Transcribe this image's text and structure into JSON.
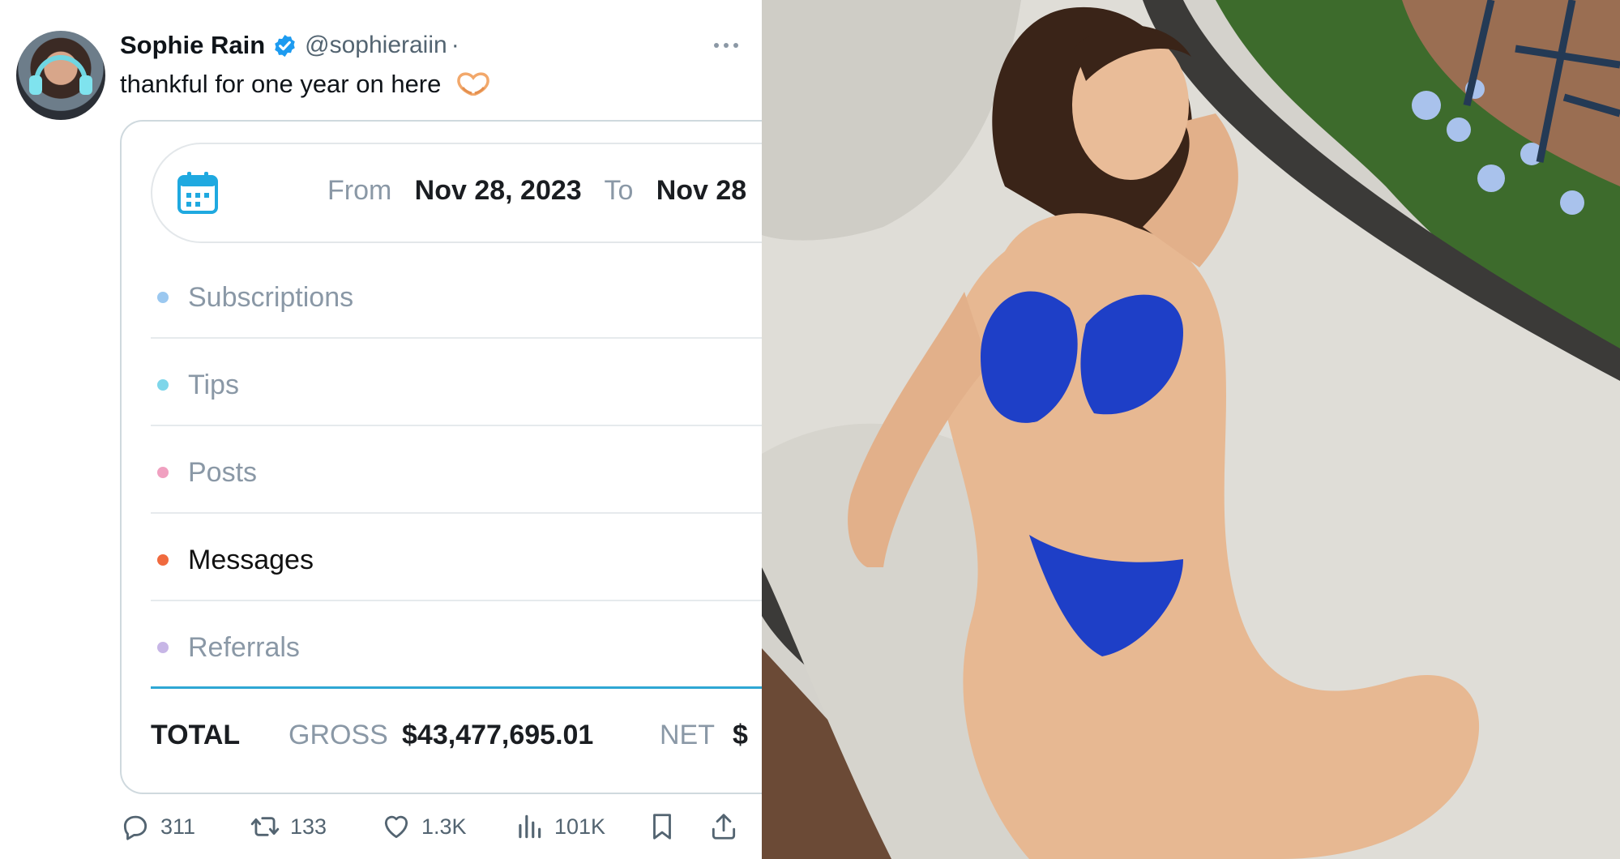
{
  "tweet": {
    "author_name": "Sophie Rain",
    "author_handle": "@sophieraiin",
    "separator": "·",
    "text": "thankful for one year on here",
    "emoji_icon": "heart-hands-icon",
    "verified_color": "#1d9bf0"
  },
  "card": {
    "from_label": "From",
    "from_date": "Nov 28, 2023",
    "to_label": "To",
    "to_date": "Nov 28",
    "categories": [
      {
        "label": "Subscriptions",
        "color": "#9bc8f0"
      },
      {
        "label": "Tips",
        "color": "#7ed6ea"
      },
      {
        "label": "Posts",
        "color": "#f0a0c0"
      },
      {
        "label": "Messages",
        "color": "#f06a3e"
      },
      {
        "label": "Referrals",
        "color": "#c7b6e6"
      }
    ],
    "total_label": "TOTAL",
    "gross_label": "GROSS",
    "gross_value": "$43,477,695.01",
    "net_label": "NET",
    "net_value": "$"
  },
  "actions": {
    "replies": "311",
    "retweets": "133",
    "likes": "1.3K",
    "views": "101K"
  }
}
